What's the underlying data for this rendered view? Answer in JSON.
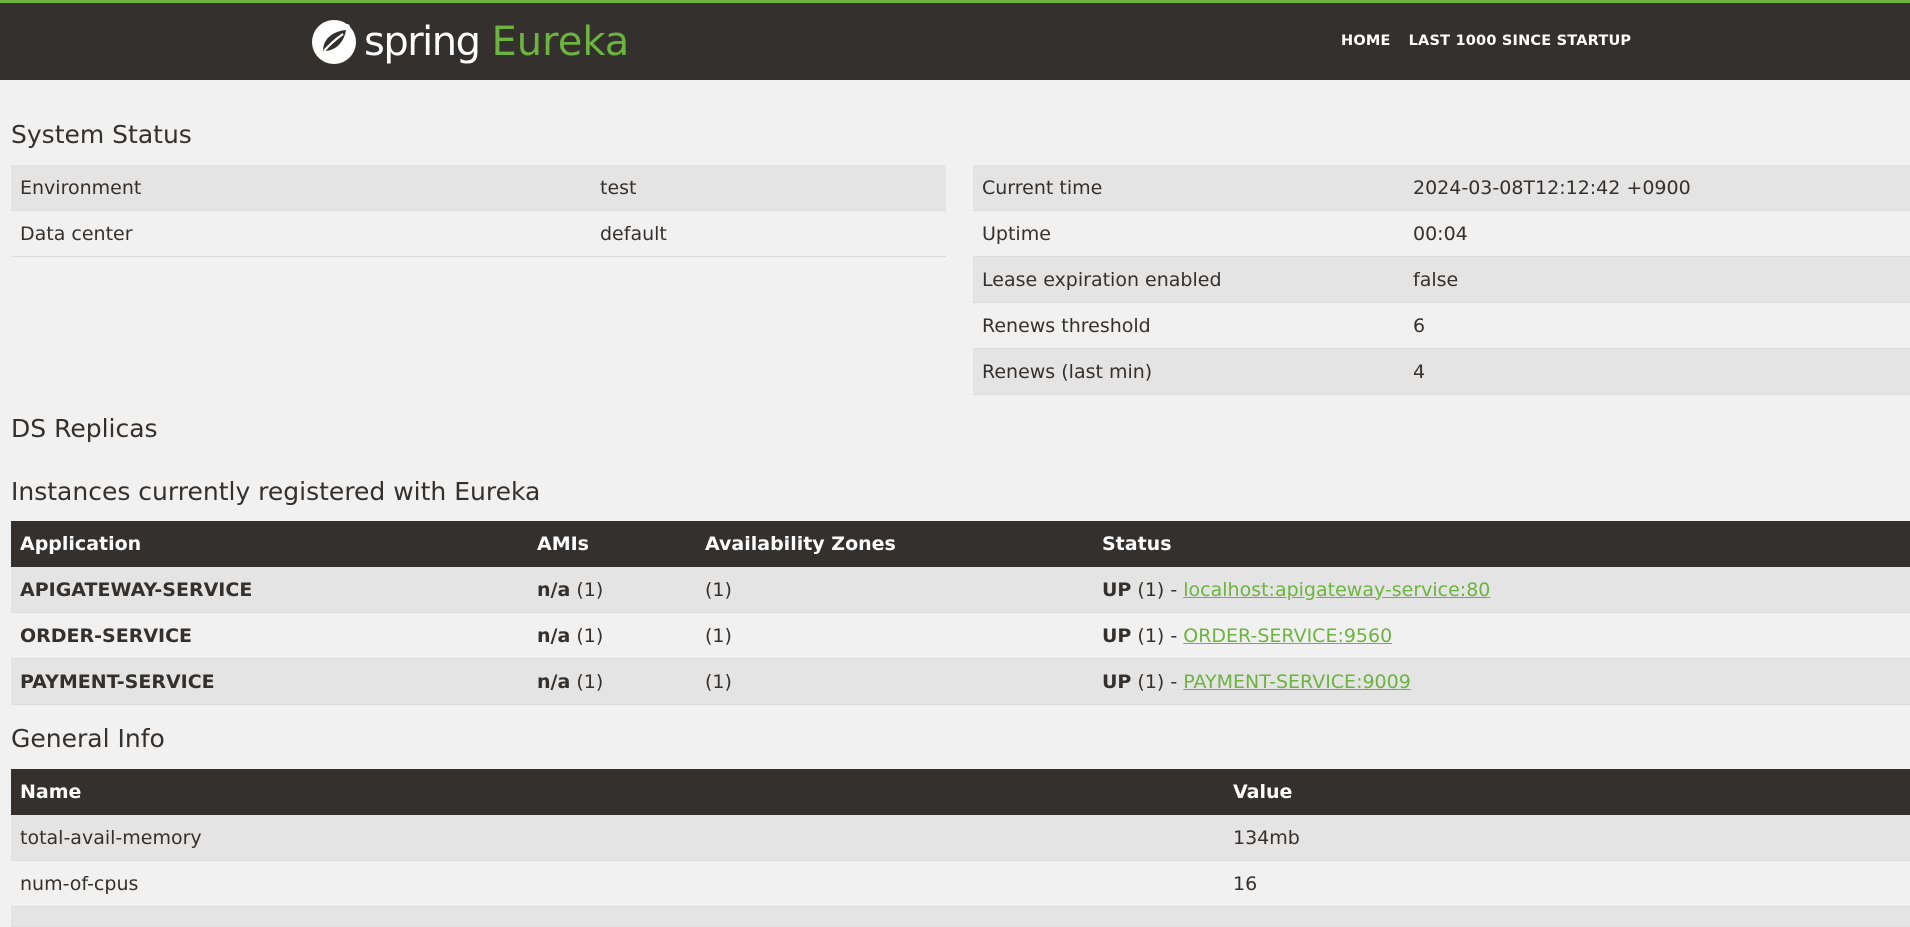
{
  "navbar": {
    "brand_spring": "spring",
    "brand_eureka": "Eureka",
    "links": [
      "HOME",
      "LAST 1000 SINCE STARTUP"
    ]
  },
  "system_status": {
    "title": "System Status",
    "left": [
      {
        "label": "Environment",
        "value": "test"
      },
      {
        "label": "Data center",
        "value": "default"
      }
    ],
    "right": [
      {
        "label": "Current time",
        "value": "2024-03-08T12:12:42 +0900"
      },
      {
        "label": "Uptime",
        "value": "00:04"
      },
      {
        "label": "Lease expiration enabled",
        "value": "false"
      },
      {
        "label": "Renews threshold",
        "value": "6"
      },
      {
        "label": "Renews (last min)",
        "value": "4"
      }
    ]
  },
  "ds_replicas": {
    "title": "DS Replicas"
  },
  "instances": {
    "title": "Instances currently registered with Eureka",
    "headers": [
      "Application",
      "AMIs",
      "Availability Zones",
      "Status"
    ],
    "rows": [
      {
        "app": "APIGATEWAY-SERVICE",
        "ami": "n/a",
        "ami_count": "(1)",
        "zones": "(1)",
        "status": "UP",
        "status_count": "(1) -",
        "link": "localhost:apigateway-service:80"
      },
      {
        "app": "ORDER-SERVICE",
        "ami": "n/a",
        "ami_count": "(1)",
        "zones": "(1)",
        "status": "UP",
        "status_count": "(1) -",
        "link": "ORDER-SERVICE:9560"
      },
      {
        "app": "PAYMENT-SERVICE",
        "ami": "n/a",
        "ami_count": "(1)",
        "zones": "(1)",
        "status": "UP",
        "status_count": "(1) -",
        "link": "PAYMENT-SERVICE:9009"
      }
    ]
  },
  "general_info": {
    "title": "General Info",
    "headers": [
      "Name",
      "Value"
    ],
    "rows": [
      {
        "name": "total-avail-memory",
        "value": "134mb"
      },
      {
        "name": "num-of-cpus",
        "value": "16"
      }
    ]
  },
  "colors": {
    "navbar_bg": "#34302d",
    "accent": "#6db33f",
    "page_bg": "#f1f1f1",
    "row_alt": "#e4e4e4"
  }
}
